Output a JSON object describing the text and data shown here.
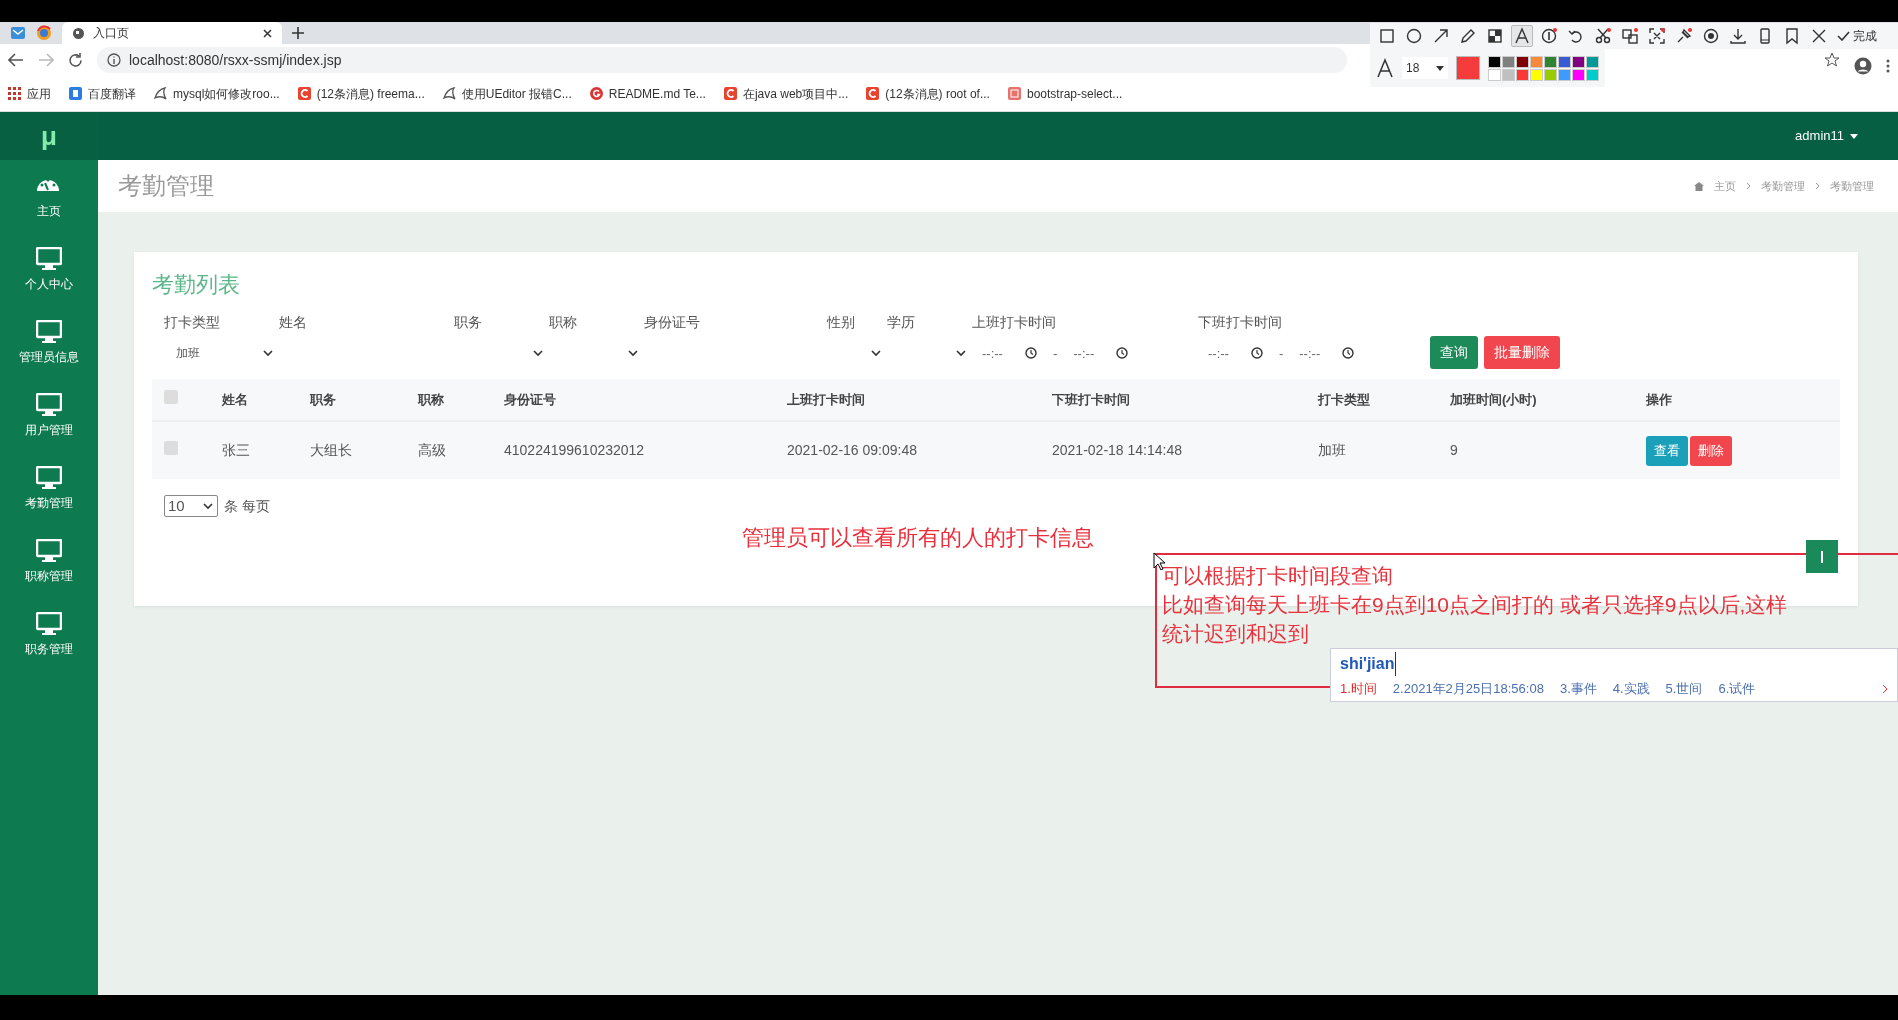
{
  "browser": {
    "tabs": [
      {
        "title": "入口页",
        "selected": true
      }
    ],
    "url": "localhost:8080/rsxx-ssmj/index.jsp",
    "bookmarks": [
      {
        "label": "应用",
        "kind": "grid"
      },
      {
        "label": "百度翻译",
        "kind": "blue"
      },
      {
        "label": "mysql如何修改roo...",
        "kind": "bird"
      },
      {
        "label": "(12条消息) freema...",
        "kind": "red"
      },
      {
        "label": "使用UEditor 报错C...",
        "kind": "bird"
      },
      {
        "label": "README.md   Te...",
        "kind": "round"
      },
      {
        "label": "在java web项目中...",
        "kind": "red"
      },
      {
        "label": "(12条消息) root of...",
        "kind": "red"
      },
      {
        "label": "bootstrap-select...",
        "kind": "pink"
      }
    ]
  },
  "capture_toolbar": {
    "tools": [
      {
        "kind": "rect",
        "selected": false
      },
      {
        "kind": "circle",
        "selected": false
      },
      {
        "kind": "arrow",
        "selected": false
      },
      {
        "kind": "pencil",
        "selected": false
      },
      {
        "kind": "mosaic",
        "selected": false
      },
      {
        "kind": "text",
        "selected": true
      },
      {
        "kind": "number",
        "selected": false
      },
      {
        "kind": "undo",
        "selected": false
      },
      {
        "kind": "scissors",
        "selected": false
      },
      {
        "kind": "translate",
        "selected": false
      },
      {
        "kind": "expand",
        "selected": false
      },
      {
        "kind": "pin",
        "selected": false
      },
      {
        "kind": "record",
        "selected": false
      },
      {
        "kind": "download",
        "selected": false
      },
      {
        "kind": "phone",
        "selected": false
      },
      {
        "kind": "bookmark",
        "selected": false
      },
      {
        "kind": "close",
        "selected": false
      }
    ],
    "done": "完成",
    "font_size": "18",
    "current_swatch": {
      "color": "#f53b3b"
    },
    "palette": [
      {
        "color": "#000000"
      },
      {
        "color": "#808080"
      },
      {
        "color": "#800000"
      },
      {
        "color": "#f7883a"
      },
      {
        "color": "#308430"
      },
      {
        "color": "#385ad3"
      },
      {
        "color": "#800080"
      },
      {
        "color": "#009999"
      },
      {
        "color": "#ffffff"
      },
      {
        "color": "#c0c0c0"
      },
      {
        "color": "#fb3838"
      },
      {
        "color": "#ffff00"
      },
      {
        "color": "#99cc00"
      },
      {
        "color": "#3d9bfb"
      },
      {
        "color": "#ff00ff"
      },
      {
        "color": "#00cccc"
      }
    ]
  },
  "app": {
    "logo": "μ",
    "user": "admin11",
    "sidebar": [
      {
        "label": "主页",
        "kind": "dashboard"
      },
      {
        "label": "个人中心",
        "kind": "monitor"
      },
      {
        "label": "管理员信息",
        "kind": "monitor"
      },
      {
        "label": "用户管理",
        "kind": "monitor"
      },
      {
        "label": "考勤管理",
        "kind": "monitor"
      },
      {
        "label": "职称管理",
        "kind": "monitor"
      },
      {
        "label": "职务管理",
        "kind": "monitor"
      }
    ],
    "page_title": "考勤管理",
    "breadcrumb": [
      "主页",
      "考勤管理",
      "考勤管理"
    ]
  },
  "card": {
    "title": "考勤列表",
    "filters": [
      {
        "label": "打卡类型",
        "kind": "select",
        "value": "加班"
      },
      {
        "label": "姓名",
        "kind": "text"
      },
      {
        "label": "职务",
        "kind": "select"
      },
      {
        "label": "职称",
        "kind": "select"
      },
      {
        "label": "身份证号",
        "kind": "text"
      },
      {
        "label": "性别",
        "kind": "select"
      },
      {
        "label": "学历",
        "kind": "select"
      },
      {
        "label": "上班打卡时间",
        "kind": "time_range",
        "from": "--:--",
        "separator": "-",
        "to": "--:--"
      },
      {
        "label": "下班打卡时间",
        "kind": "time_range",
        "from": "--:--",
        "separator": "-",
        "to": "--:--"
      }
    ],
    "buttons": [
      {
        "label": "查询",
        "kind": "success"
      },
      {
        "label": "批量删除",
        "kind": "danger"
      }
    ],
    "table": {
      "select_all": {
        "checked": false
      },
      "columns": [
        "姓名",
        "职务",
        "职称",
        "身份证号",
        "上班打卡时间",
        "下班打卡时间",
        "打卡类型",
        "加班时间(小时)",
        "操作"
      ],
      "rows": [
        {
          "checked": false,
          "cells": [
            "张三",
            "大组长",
            "高级",
            "410224199610232012",
            "2021-02-16 09:09:48",
            "2021-02-18 14:14:48",
            "加班",
            "9"
          ],
          "actions": [
            {
              "label": "查看",
              "kind": "info"
            },
            {
              "label": "删除",
              "kind": "danger"
            }
          ]
        }
      ]
    },
    "page_size": "10",
    "page_size_label": "条 每页"
  },
  "annotations": {
    "note": "管理员可以查看所有的人的打卡信息",
    "text_box": [
      "可以根据打卡时间段查询",
      "比如查询每天上班卡在9点到10点之间打的  或者只选择9点以后,这样",
      "统计迟到和迟到"
    ],
    "ime": {
      "input": "shi'jian",
      "candidates": [
        {
          "label": "1.时间",
          "selected": true
        },
        {
          "label": "2.2021年2月25日18:56:08",
          "selected": false
        },
        {
          "label": "3.事件",
          "selected": false
        },
        {
          "label": "4.实践",
          "selected": false
        },
        {
          "label": "5.世间",
          "selected": false
        },
        {
          "label": "6.试件",
          "selected": false
        }
      ]
    }
  }
}
